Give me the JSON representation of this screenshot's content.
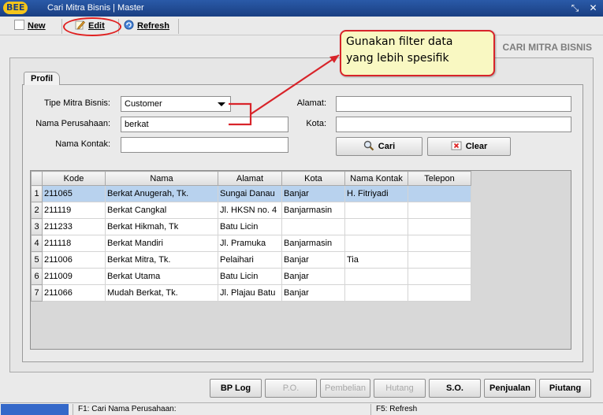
{
  "window": {
    "logo": "BEE",
    "title": "Cari Mitra Bisnis | Master"
  },
  "toolbar": {
    "new_label": "New",
    "edit_label": "Edit",
    "refresh_label": "Refresh"
  },
  "header_title": "CARI MITRA BISNIS",
  "tab": {
    "label": "Profil"
  },
  "form": {
    "tipe_label": "Tipe Mitra Bisnis:",
    "tipe_value": "Customer",
    "nama_perusahaan_label": "Nama Perusahaan:",
    "nama_perusahaan_value": "berkat",
    "nama_kontak_label": "Nama Kontak:",
    "nama_kontak_value": "",
    "alamat_label": "Alamat:",
    "alamat_value": "",
    "kota_label": "Kota:",
    "kota_value": "",
    "cari_label": "Cari",
    "clear_label": "Clear"
  },
  "table": {
    "columns": [
      "Kode",
      "Nama",
      "Alamat",
      "Kota",
      "Nama Kontak",
      "Telepon"
    ],
    "rows": [
      {
        "no": "1",
        "kode": "211065",
        "nama": "Berkat Anugerah, Tk.",
        "alamat": "Sungai Danau",
        "kota": "Banjar",
        "kontak": "H. Fitriyadi",
        "telepon": ""
      },
      {
        "no": "2",
        "kode": "211119",
        "nama": "Berkat Cangkal",
        "alamat": "Jl. HKSN no. 4",
        "kota": "Banjarmasin",
        "kontak": "",
        "telepon": ""
      },
      {
        "no": "3",
        "kode": "211233",
        "nama": "Berkat Hikmah, Tk",
        "alamat": "Batu Licin",
        "kota": "",
        "kontak": "",
        "telepon": ""
      },
      {
        "no": "4",
        "kode": "211118",
        "nama": "Berkat Mandiri",
        "alamat": "Jl. Pramuka",
        "kota": "Banjarmasin",
        "kontak": "",
        "telepon": ""
      },
      {
        "no": "5",
        "kode": "211006",
        "nama": "Berkat Mitra, Tk.",
        "alamat": "Pelaihari",
        "kota": "Banjar",
        "kontak": "Tia",
        "telepon": ""
      },
      {
        "no": "6",
        "kode": "211009",
        "nama": "Berkat Utama",
        "alamat": "Batu Licin",
        "kota": "Banjar",
        "kontak": "",
        "telepon": ""
      },
      {
        "no": "7",
        "kode": "211066",
        "nama": "Mudah Berkat, Tk.",
        "alamat": "Jl. Plajau    Batu",
        "kota": "Banjar",
        "kontak": "",
        "telepon": ""
      }
    ]
  },
  "bottom_buttons": {
    "bp_log": "BP Log",
    "po": "P.O.",
    "pembelian": "Pembelian",
    "hutang": "Hutang",
    "so": "S.O.",
    "penjualan": "Penjualan",
    "piutang": "Piutang"
  },
  "status": {
    "f1": "F1: Cari Nama Perusahaan:",
    "f5": "F5: Refresh"
  },
  "callout": {
    "line1": "Gunakan filter data",
    "line2": "yang lebih spesifik"
  },
  "colors": {
    "titlebar": "#1a3f82",
    "selection": "#b8d2ee",
    "annotation_red": "#d8242a",
    "callout_bg": "#f9f8c2"
  }
}
